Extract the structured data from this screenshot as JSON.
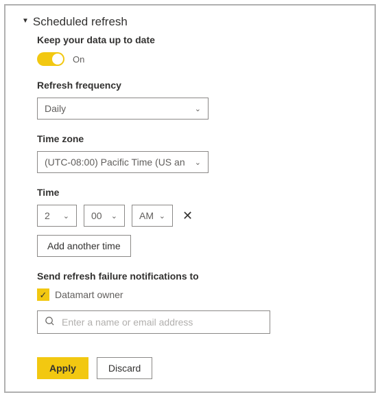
{
  "section": {
    "title": "Scheduled refresh"
  },
  "keep": {
    "heading": "Keep your data up to date",
    "toggle_label": "On"
  },
  "frequency": {
    "heading": "Refresh frequency",
    "value": "Daily"
  },
  "timezone": {
    "heading": "Time zone",
    "value": "(UTC-08:00) Pacific Time (US an"
  },
  "time": {
    "heading": "Time",
    "hour": "2",
    "minute": "00",
    "ampm": "AM",
    "add_label": "Add another time"
  },
  "notify": {
    "heading": "Send refresh failure notifications to",
    "owner_label": "Datamart owner",
    "placeholder": "Enter a name or email address"
  },
  "actions": {
    "apply": "Apply",
    "discard": "Discard"
  }
}
